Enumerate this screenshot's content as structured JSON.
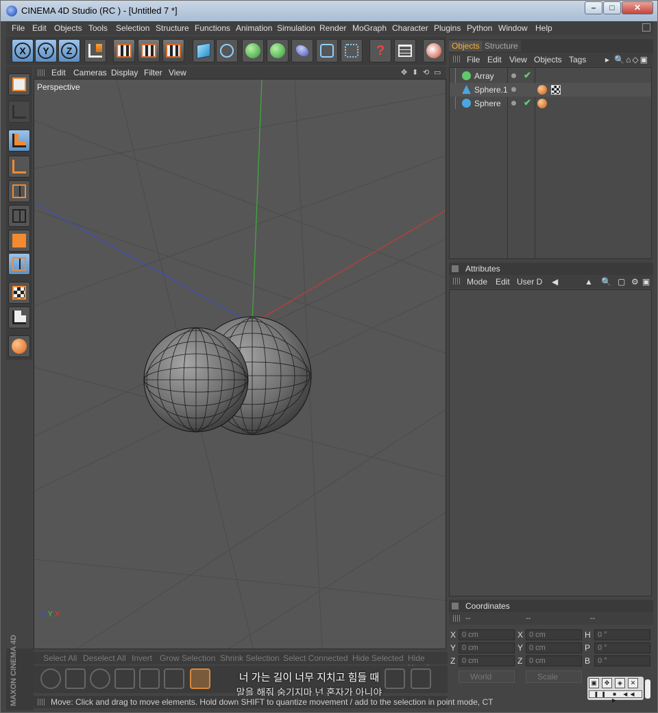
{
  "window": {
    "title": "CINEMA 4D Studio (RC ) - [Untitled 7 *]",
    "controls": [
      "–",
      "□",
      "✕"
    ]
  },
  "menubar": [
    "File",
    "Edit",
    "Objects",
    "Tools",
    "Selection",
    "Structure",
    "Functions",
    "Animation",
    "Simulation",
    "Render",
    "MoGraph",
    "Character",
    "Plugins",
    "Python",
    "Window",
    "Help"
  ],
  "toolbar": {
    "axis_buttons": [
      "X",
      "Y",
      "Z"
    ]
  },
  "viewport": {
    "menu": [
      "Edit",
      "Cameras",
      "Display",
      "Filter",
      "View"
    ],
    "camera_label": "Perspective",
    "axis_gizmo": {
      "z": "Z",
      "y": "Y",
      "x": "X"
    }
  },
  "bottom_commands": [
    "Select All",
    "Deselect All",
    "Invert",
    "Grow Selection",
    "Shrink Selection",
    "Select Connected",
    "Hide Selected",
    "Hide Unsel"
  ],
  "subtitle": {
    "line1": "너 가는 길이 너무 지치고 힘들 때",
    "line2": "말을 해줘 숨기지마 넌 혼자가 아니야"
  },
  "status": "Move: Click and drag to move elements. Hold down SHIFT to quantize movement / add to the selection in point mode, CT",
  "maxon": "MAXON CINEMA 4D",
  "object_manager": {
    "tabs": [
      "Objects",
      "Structure"
    ],
    "menu": [
      "File",
      "Edit",
      "View",
      "Objects",
      "Tags"
    ],
    "objects": [
      {
        "name": "Array",
        "icon_color": "#5fc86b",
        "checked": true,
        "tags": []
      },
      {
        "name": "Sphere.1",
        "icon_color": "#4aa6e0",
        "checked": false,
        "tags": [
          "material",
          "texture"
        ]
      },
      {
        "name": "Sphere",
        "icon_color": "#4aa6e0",
        "checked": true,
        "tags": [
          "material"
        ]
      }
    ]
  },
  "attributes": {
    "title": "Attributes",
    "menu": [
      "Mode",
      "Edit",
      "User D"
    ]
  },
  "coordinates": {
    "title": "Coordinates",
    "col_headers": [
      "--",
      "--",
      "--"
    ],
    "rows": [
      {
        "a": "X",
        "av": "0 cm",
        "b": "X",
        "bv": "0 cm",
        "c": "H",
        "cv": "0 °"
      },
      {
        "a": "Y",
        "av": "0 cm",
        "b": "Y",
        "bv": "0 cm",
        "c": "P",
        "cv": "0 °"
      },
      {
        "a": "Z",
        "av": "0 cm",
        "b": "Z",
        "bv": "0 cm",
        "c": "B",
        "cv": "0 °"
      }
    ],
    "dropdown_world": "World",
    "dropdown_scale": "Scale"
  },
  "colors": {
    "accent_tab": "#ffb030",
    "x_axis": "#c83a32",
    "y_axis": "#3fae3a",
    "z_axis": "#3b4dc8"
  }
}
